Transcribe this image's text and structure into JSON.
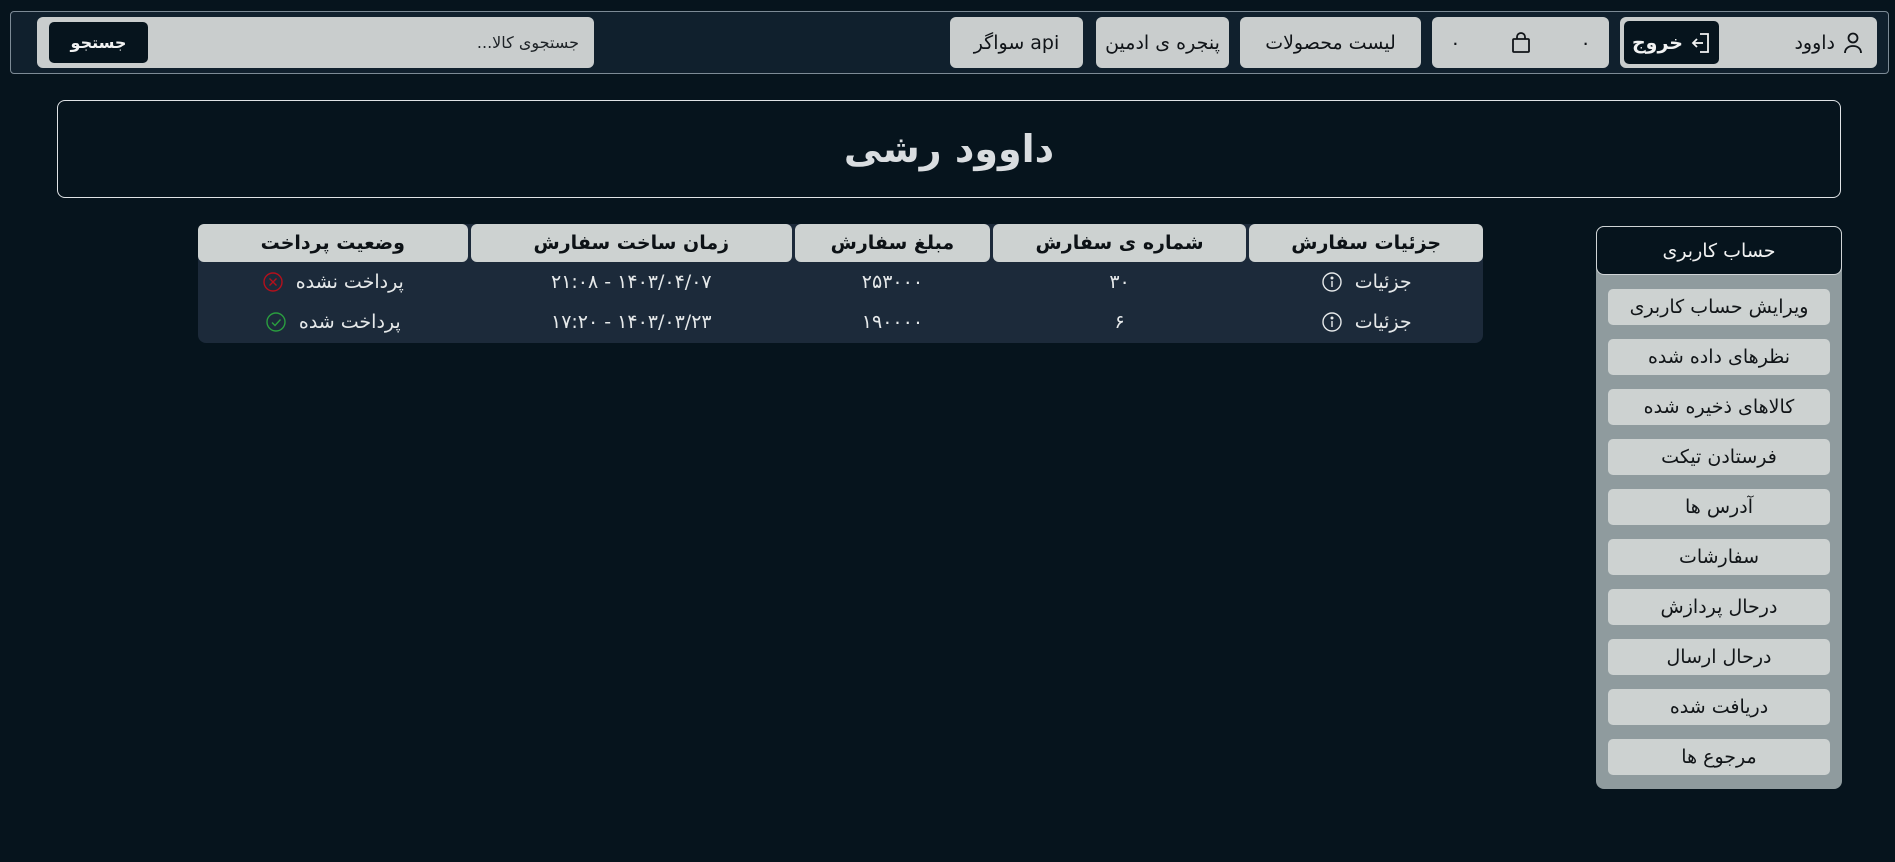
{
  "header": {
    "username": "داوود",
    "logout_label": "خروج",
    "cart_count": "۰",
    "cart_total": "۰",
    "products_label": "لیست محصولات",
    "admin_label": "پنجره ی ادمین",
    "swagger_label": "سواگر api",
    "search_placeholder": "جستجوی کالا...",
    "search_button": "جستجو"
  },
  "profile": {
    "full_name": "داوود رشی"
  },
  "orders": {
    "columns": [
      "جزئیات سفارش",
      "شماره ی سفارش",
      "مبلغ سفارش",
      "زمان ساخت سفارش",
      "وضعیت پرداخت"
    ],
    "rows": [
      {
        "details": "جزئیات",
        "number": "۳۰",
        "amount": "۲۵۳۰۰۰",
        "created": "۱۴۰۳/۰۴/۰۷ - ۲۱:۰۸",
        "status": "پرداخت نشده",
        "paid": false
      },
      {
        "details": "جزئیات",
        "number": "۶",
        "amount": "۱۹۰۰۰۰",
        "created": "۱۴۰۳/۰۳/۲۳ - ۱۷:۲۰",
        "status": "پرداخت شده",
        "paid": true
      }
    ]
  },
  "sidebar": {
    "title": "حساب کاربری",
    "items": [
      {
        "label": "ویرایش حساب کاربری"
      },
      {
        "label": "نظرهای داده شده"
      },
      {
        "label": "کالاهای ذخیره شده"
      },
      {
        "label": "فرستادن تیکت"
      },
      {
        "label": "آدرس ها"
      },
      {
        "label": "سفارشات"
      },
      {
        "label": "درحال پردازش"
      },
      {
        "label": "درحال ارسال"
      },
      {
        "label": "دریافت شده"
      },
      {
        "label": "مرجوع ها"
      }
    ]
  },
  "colors": {
    "background": "#06141d",
    "panel": "#1c2a3a",
    "unpaid": "#b3101c",
    "paid": "#2a9d3f"
  },
  "icons": [
    "user-icon",
    "logout-icon",
    "shopping-bag-icon",
    "info-icon",
    "x-circle-icon",
    "check-circle-icon"
  ]
}
